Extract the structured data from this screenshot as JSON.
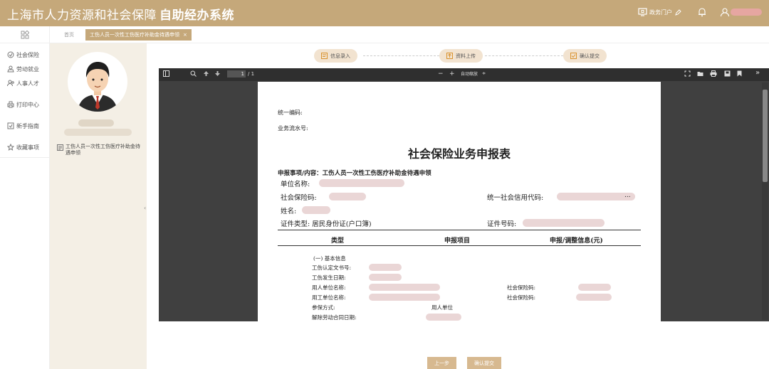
{
  "header": {
    "system_name": "上海市人力资源和社会保障",
    "system_subtitle": "自助经办系统",
    "portal_label": "政务门户",
    "colors": {
      "header_bg": "#c5a87a",
      "accent": "#d7b990"
    }
  },
  "leftnav": {
    "items": [
      {
        "label": "社会保险",
        "icon": "shield-icon"
      },
      {
        "label": "劳动就业",
        "icon": "worker-icon"
      },
      {
        "label": "人事人才",
        "icon": "people-icon"
      },
      {
        "label": "打印中心",
        "icon": "printer-icon"
      },
      {
        "label": "新手指南",
        "icon": "guide-icon"
      },
      {
        "label": "收藏事项",
        "icon": "star-icon"
      }
    ]
  },
  "tabs": {
    "home_label": "首页",
    "active_label": "工伤人员一次性工伤医疗补助金待遇申领",
    "close_glyph": "×"
  },
  "profile": {
    "item_label": "工伤人员一次性工伤医疗补助金待遇申领"
  },
  "steps": [
    {
      "label": "信息录入"
    },
    {
      "label": "资料上传"
    },
    {
      "label": "确认提交"
    }
  ],
  "viewer": {
    "page_current": "1",
    "page_total": "/ 1",
    "zoom_minus": "−",
    "zoom_plus": "+",
    "zoom_label": "自动缩放",
    "zoom_caret": "≑",
    "more_glyph": "»"
  },
  "document": {
    "code_label": "统一编码:",
    "serial_label": "业务流水号:",
    "title": "社会保险业务申报表",
    "matter_label": "申报事项/内容：工伤人员一次性工伤医疗补助金待遇申领",
    "unit_name_label": "单位名称:",
    "social_code_label": "社会保险码:",
    "credit_code_label": "统一社会信用代码:",
    "credit_code_suffix": "...",
    "name_label": "姓名:",
    "id_type_label": "证件类型: 居民身份证(户口簿)",
    "id_number_label": "证件号码:",
    "table_headers": [
      "类型",
      "申报项目",
      "申报/调整信息(元)"
    ],
    "section_basic": "(一) 基本信息",
    "rows": [
      "工伤认定文书号:",
      "工伤发生日期:",
      "用人单位名称:",
      "用工单位名称:",
      "参保方式:",
      "解除劳动合同日期:"
    ],
    "social_code_row_label": "社会保险码:",
    "insured_type_value": "用人单位"
  },
  "footer": {
    "prev_label": "上一步",
    "submit_label": "确认提交"
  }
}
